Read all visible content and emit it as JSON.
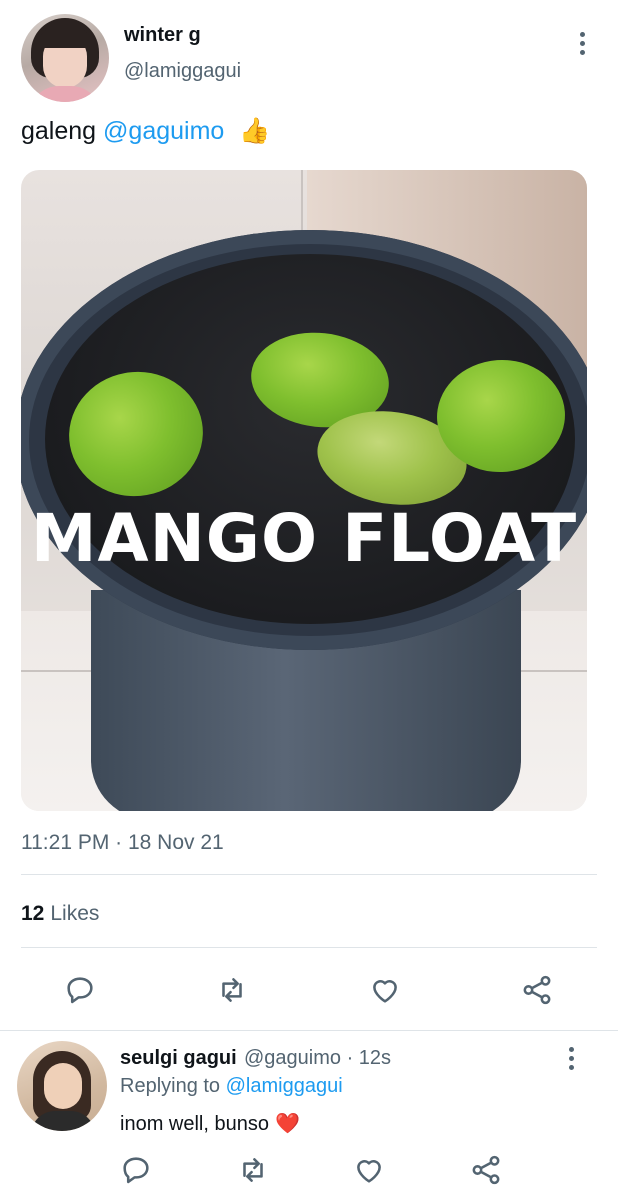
{
  "tweet": {
    "author_name": "winter g",
    "author_handle": "@lamiggagui",
    "text_prefix": "galeng",
    "text_mention": "@gaguimo",
    "text_emoji": "👍",
    "media_overlay": "MANGO FLOAT",
    "timestamp": "11:21 PM · 18 Nov 21",
    "likes_count": "12",
    "likes_label": "Likes"
  },
  "actions": {
    "reply_icon": "reply-icon",
    "retweet_icon": "retweet-icon",
    "like_icon": "heart-icon",
    "share_icon": "share-icon"
  },
  "reply": {
    "author_name": "seulgi gagui",
    "author_handle": "@gaguimo · 12s",
    "replying_prefix": "Replying to",
    "replying_to": "@lamiggagui",
    "text": "inom well, bunso",
    "text_emoji": "❤️"
  },
  "colors": {
    "accent": "#1d9bf0",
    "secondary_text": "#536471",
    "primary_text": "#0f1419",
    "divider": "#dfe4e8"
  }
}
